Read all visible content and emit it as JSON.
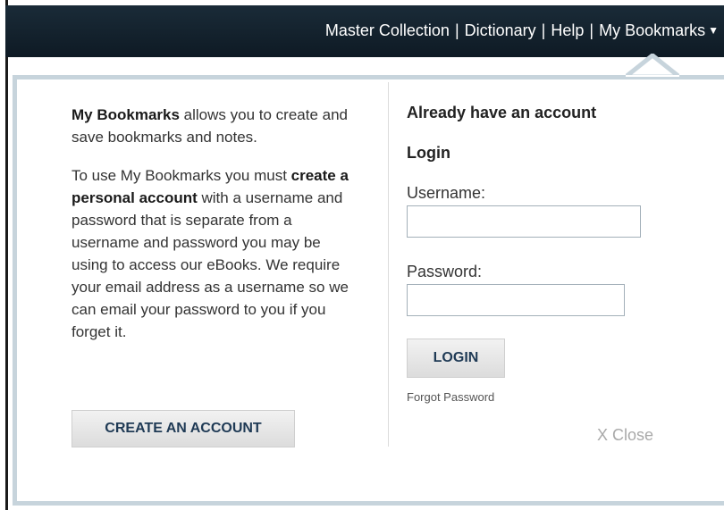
{
  "topnav": {
    "items": [
      "Master Collection",
      "Dictionary",
      "Help",
      "My Bookmarks"
    ],
    "dropdown_icon": "caret-down-icon"
  },
  "intro": {
    "p1_bold": "My Bookmarks",
    "p1_rest": " allows you to create and save bookmarks and notes.",
    "p2_a": "To use My Bookmarks you must ",
    "p2_bold": "create a personal account",
    "p2_b": " with a username and password that is separate from a username and password you may be using to access our eBooks. We require your email address as a username so we can email your password to you if you forget it."
  },
  "create_account_label": "CREATE AN ACCOUNT",
  "login": {
    "already_heading": "Already have an account",
    "login_heading": "Login",
    "username_label": "Username:",
    "username_value": "",
    "password_label": "Password:",
    "password_value": "",
    "login_button": "LOGIN",
    "forgot_link": "Forgot Password"
  },
  "close_label": "X Close",
  "colors": {
    "topbar": "#14222e",
    "panel_border": "#c7d4dc",
    "button_text": "#1f3a55"
  }
}
